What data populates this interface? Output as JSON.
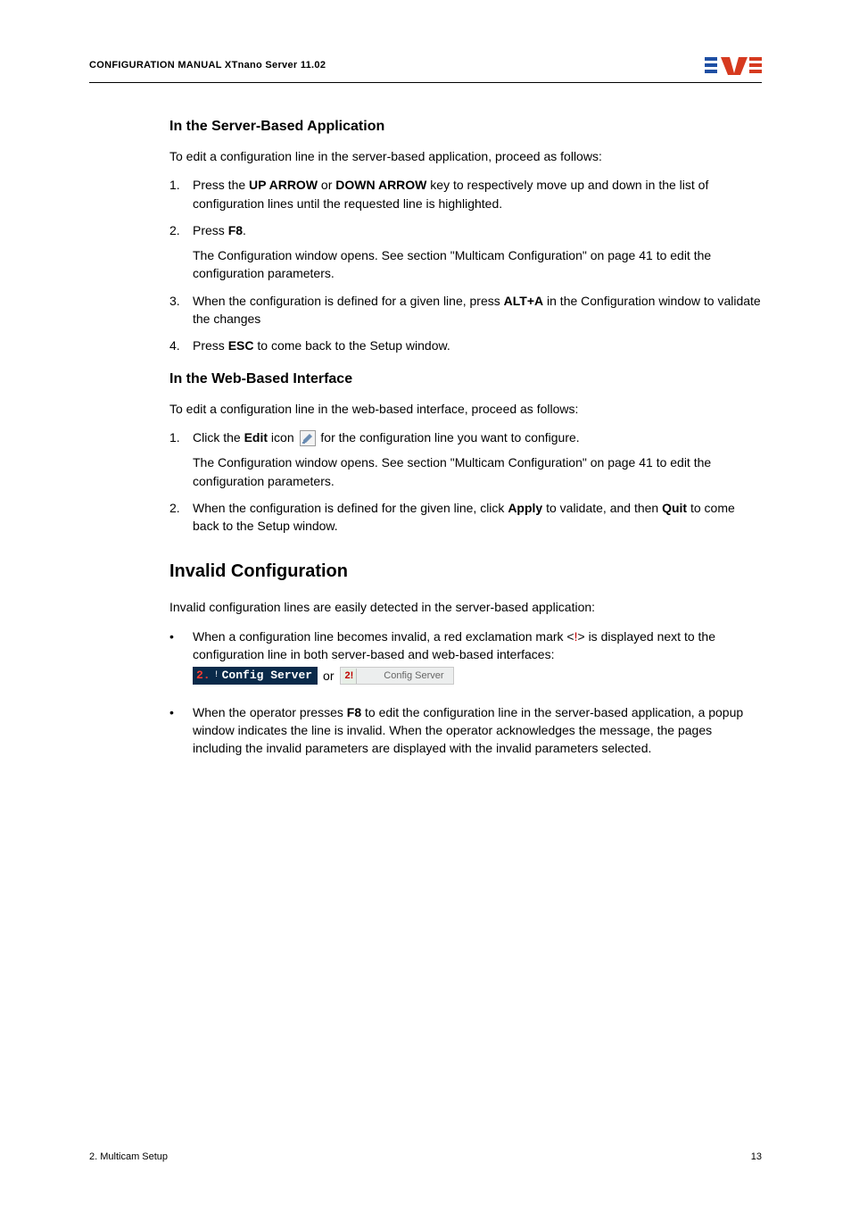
{
  "header": {
    "title": "CONFIGURATION MANUAL  XTnano Server 11.02"
  },
  "section1": {
    "heading": "In the Server-Based Application",
    "intro": "To edit a configuration line in the server-based application, proceed as follows:",
    "steps": [
      {
        "n": "1.",
        "pre": "Press the ",
        "b1": "UP ARROW",
        "mid": " or ",
        "b2": "DOWN ARROW",
        "post": " key to respectively move up and down in the list of configuration lines until the requested line is highlighted."
      },
      {
        "n": "2.",
        "pre": "Press ",
        "b1": "F8",
        "post": ".",
        "sub": "The Configuration window opens. See section \"Multicam Configuration\" on page 41 to edit the configuration parameters."
      },
      {
        "n": "3.",
        "pre": "When the configuration is defined for a given line, press ",
        "b1": "ALT+A",
        "post": " in the Configuration window to validate the changes"
      },
      {
        "n": "4.",
        "pre": "Press ",
        "b1": "ESC",
        "post": " to come back to the Setup window."
      }
    ]
  },
  "section2": {
    "heading": "In the Web-Based Interface",
    "intro": "To edit a configuration line in the web-based interface, proceed as follows:",
    "step1_pre": "Click the ",
    "step1_b": "Edit",
    "step1_mid": " icon ",
    "step1_post": " for the configuration line you want to configure.",
    "step1_sub": "The Configuration window opens. See section \"Multicam Configuration\" on page 41 to edit the configuration parameters.",
    "step2_pre": "When the configuration is defined for the given line, click ",
    "step2_b1": "Apply",
    "step2_mid": " to validate, and then ",
    "step2_b2": "Quit",
    "step2_post": " to come back to the Setup window."
  },
  "section3": {
    "heading": "Invalid Configuration",
    "intro": "Invalid configuration lines are easily detected in the server-based application:",
    "bullet1_pre": "When a configuration line becomes invalid, a red exclamation mark <",
    "bullet1_mark": "!",
    "bullet1_post": "> is displayed next to the configuration line in both server-based and web-based interfaces:",
    "server_idx": "2.",
    "server_marker": "!",
    "server_txt": "Config Server",
    "or": "or",
    "web_flag": "2!",
    "web_txt": "Config Server",
    "bullet2_pre": "When the operator presses ",
    "bullet2_b": "F8",
    "bullet2_post": " to edit the configuration line in the server-based application, a popup window indicates the line is invalid. When the operator acknowledges the message, the pages including the invalid parameters are displayed with the invalid parameters selected."
  },
  "footer": {
    "left": "2. Multicam Setup",
    "right": "13"
  }
}
